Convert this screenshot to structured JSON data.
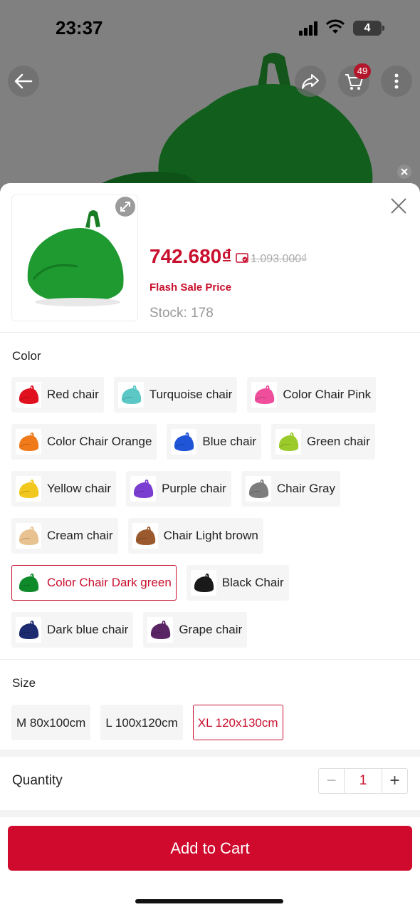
{
  "status_bar": {
    "time": "23:37",
    "battery": "4"
  },
  "header": {
    "cart_count": "49"
  },
  "product": {
    "price": "742.680₫",
    "original_price": "1.093.000₫",
    "flash_label": "Flash Sale Price",
    "stock": "Stock: 178"
  },
  "color_section": {
    "label": "Color",
    "options": [
      {
        "label": "Red chair",
        "color": "#e0101f"
      },
      {
        "label": "Turquoise chair",
        "color": "#5cc8c6"
      },
      {
        "label": "Color Chair Pink",
        "color": "#ee4e9c"
      },
      {
        "label": "Color Chair Orange",
        "color": "#f07a1a"
      },
      {
        "label": "Blue chair",
        "color": "#1f55d6"
      },
      {
        "label": "Green chair",
        "color": "#9acb2b"
      },
      {
        "label": "Yellow chair",
        "color": "#f2c81e"
      },
      {
        "label": "Purple chair",
        "color": "#7a3fd0"
      },
      {
        "label": "Chair Gray",
        "color": "#7d7d7d"
      },
      {
        "label": "Cream chair",
        "color": "#e8c391"
      },
      {
        "label": "Chair Light brown",
        "color": "#9a5a2e"
      },
      {
        "label": "Color Chair Dark green",
        "color": "#0e8a2b",
        "selected": true
      },
      {
        "label": "Black Chair",
        "color": "#1a1a1a"
      },
      {
        "label": "Dark blue chair",
        "color": "#1c2a70"
      },
      {
        "label": "Grape chair",
        "color": "#5b2565"
      }
    ]
  },
  "size_section": {
    "label": "Size",
    "options": [
      {
        "label": "M 80x100cm"
      },
      {
        "label": "L 100x120cm"
      },
      {
        "label": "XL 120x130cm",
        "selected": true
      }
    ]
  },
  "quantity": {
    "label": "Quantity",
    "value": "1",
    "minus": "−",
    "plus": "+"
  },
  "cta": {
    "label": "Add to Cart"
  },
  "colors": {
    "accent": "#c8102e",
    "cta_bg": "#cf0a2c"
  }
}
